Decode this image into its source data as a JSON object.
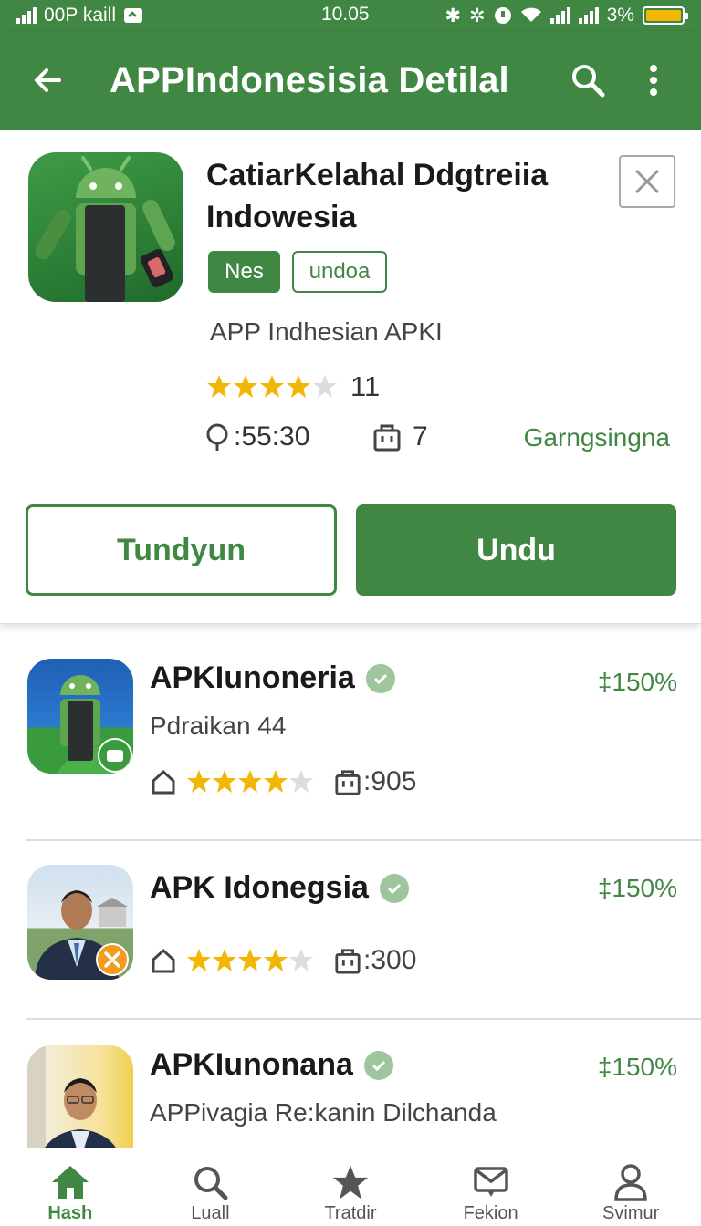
{
  "status_bar": {
    "carrier": "00P kaill",
    "time": "10.05",
    "battery_text": "3%"
  },
  "appbar": {
    "title": "APPIndonesisia Detilal"
  },
  "detail": {
    "app_title": "CatiarKelahal Ddgtreiia Indowesia",
    "chip_primary": "Nes",
    "chip_secondary": "undoa",
    "subtitle": "APP Indhesian APKI",
    "rating_count": "11",
    "meta_time": ":55:30",
    "meta_count": "7",
    "meta_label": "Garngsingna",
    "button_outline": "Tundyun",
    "button_fill": "Undu"
  },
  "list_items": [
    {
      "name": "APKIunoneria",
      "percent": "‡150%",
      "desc": "Pdraikan 44",
      "stat": ":905"
    },
    {
      "name": "APK Idonegsia",
      "percent": "‡150%",
      "desc": "",
      "stat": ":300"
    },
    {
      "name": "APKIunonana",
      "percent": "‡150%",
      "desc": "APPivagia Re:kanin Dilchanda",
      "stat": ""
    }
  ],
  "bottom_nav": [
    {
      "label": "Hash",
      "icon": "home-icon"
    },
    {
      "label": "Luall",
      "icon": "search-icon"
    },
    {
      "label": "Tratdir",
      "icon": "star-icon"
    },
    {
      "label": "Fekion",
      "icon": "mail-icon"
    },
    {
      "label": "Svimur",
      "icon": "person-icon"
    }
  ],
  "colors": {
    "primary": "#3f8743",
    "star": "#f2b705",
    "star_empty": "#dddddd"
  }
}
